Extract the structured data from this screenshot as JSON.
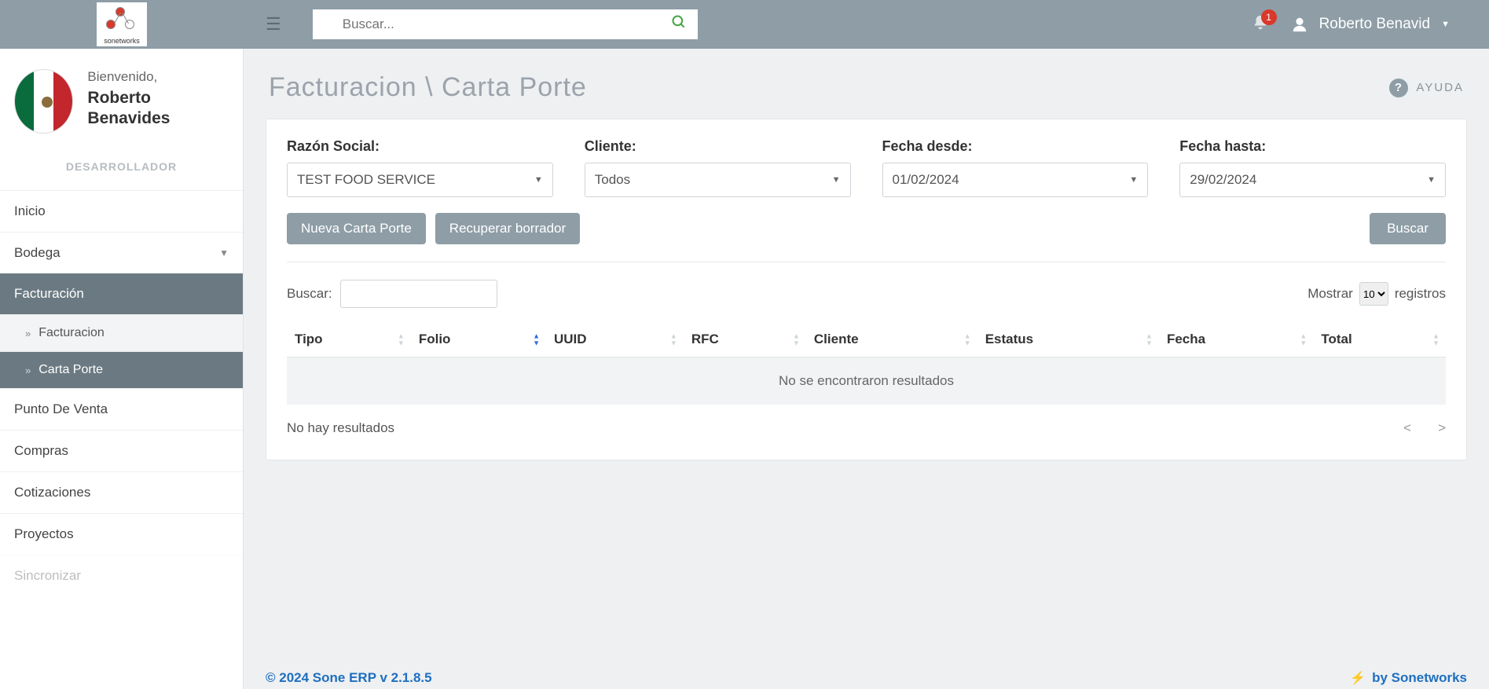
{
  "topbar": {
    "logo_text": "sonetworks",
    "search_placeholder": "Buscar...",
    "notifications": "1",
    "user_display": "Roberto Benavid"
  },
  "sidebar": {
    "welcome": "Bienvenido,",
    "user_full": "Roberto Benavides",
    "role": "DESARROLLADOR",
    "items": {
      "inicio": "Inicio",
      "bodega": "Bodega",
      "facturacion": "Facturación",
      "sub_facturacion": "Facturacion",
      "sub_cartaporte": "Carta Porte",
      "pdv": "Punto De Venta",
      "compras": "Compras",
      "cotizaciones": "Cotizaciones",
      "proyectos": "Proyectos",
      "sincronizar": "Sincronizar"
    }
  },
  "page": {
    "title": "Facturacion \\ Carta Porte",
    "help": "AYUDA"
  },
  "filters": {
    "razon_label": "Razón Social:",
    "razon_value": "TEST FOOD SERVICE",
    "cliente_label": "Cliente:",
    "cliente_value": "Todos",
    "desde_label": "Fecha desde:",
    "desde_value": "01/02/2024",
    "hasta_label": "Fecha hasta:",
    "hasta_value": "29/02/2024"
  },
  "actions": {
    "nueva": "Nueva Carta Porte",
    "recuperar": "Recuperar borrador",
    "buscar": "Buscar"
  },
  "table": {
    "search_label": "Buscar:",
    "show_prefix": "Mostrar",
    "show_value": "10",
    "show_suffix": "registros",
    "headers": {
      "tipo": "Tipo",
      "folio": "Folio",
      "uuid": "UUID",
      "rfc": "RFC",
      "cliente": "Cliente",
      "estatus": "Estatus",
      "fecha": "Fecha",
      "total": "Total"
    },
    "empty": "No se encontraron resultados",
    "info": "No hay resultados",
    "prev": "<",
    "next": ">"
  },
  "footer": {
    "left": "© 2024 Sone ERP v 2.1.8.5",
    "right": "by Sonetworks"
  }
}
